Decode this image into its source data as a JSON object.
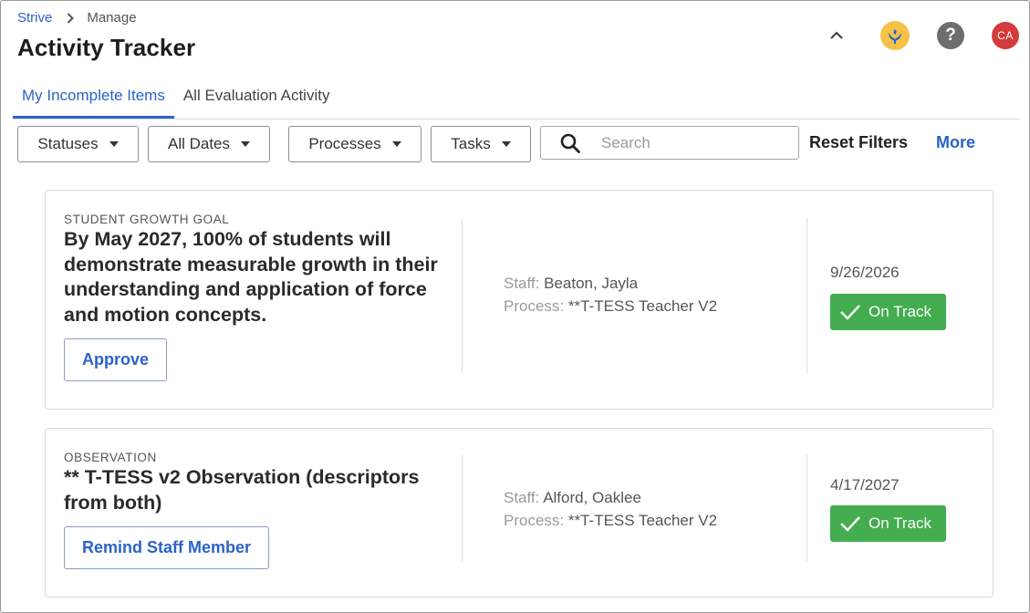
{
  "breadcrumb": {
    "root": "Strive",
    "current": "Manage"
  },
  "page": {
    "title": "Activity Tracker"
  },
  "header": {
    "avatar_initials": "CA",
    "help_label": "?"
  },
  "tabs": [
    {
      "label": "My Incomplete Items",
      "active": true
    },
    {
      "label": "All Evaluation Activity",
      "active": false
    }
  ],
  "filters": {
    "statuses": "Statuses",
    "dates": "All Dates",
    "processes": "Processes",
    "tasks": "Tasks",
    "search_placeholder": "Search",
    "reset": "Reset Filters",
    "more": "More"
  },
  "cards": [
    {
      "type": "STUDENT GROWTH GOAL",
      "title": "By May 2027, 100% of students will demonstrate measurable growth in their understanding and application of force and motion concepts.",
      "action": "Approve",
      "staff_label": "Staff:",
      "staff": "Beaton, Jayla",
      "process_label": "Process:",
      "process": "**T-TESS Teacher V2",
      "date": "9/26/2026",
      "status": "On Track"
    },
    {
      "type": "OBSERVATION",
      "title": "** T-TESS v2 Observation (descriptors from both)",
      "action": "Remind Staff Member",
      "staff_label": "Staff:",
      "staff": "Alford, Oaklee",
      "process_label": "Process:",
      "process": "**T-TESS Teacher V2",
      "date": "4/17/2027",
      "status": "On Track"
    }
  ],
  "colors": {
    "accent": "#2b63c9",
    "status_on_track": "#43ad4f",
    "avatar": "#d43b3b",
    "logo": "#f4c247"
  }
}
